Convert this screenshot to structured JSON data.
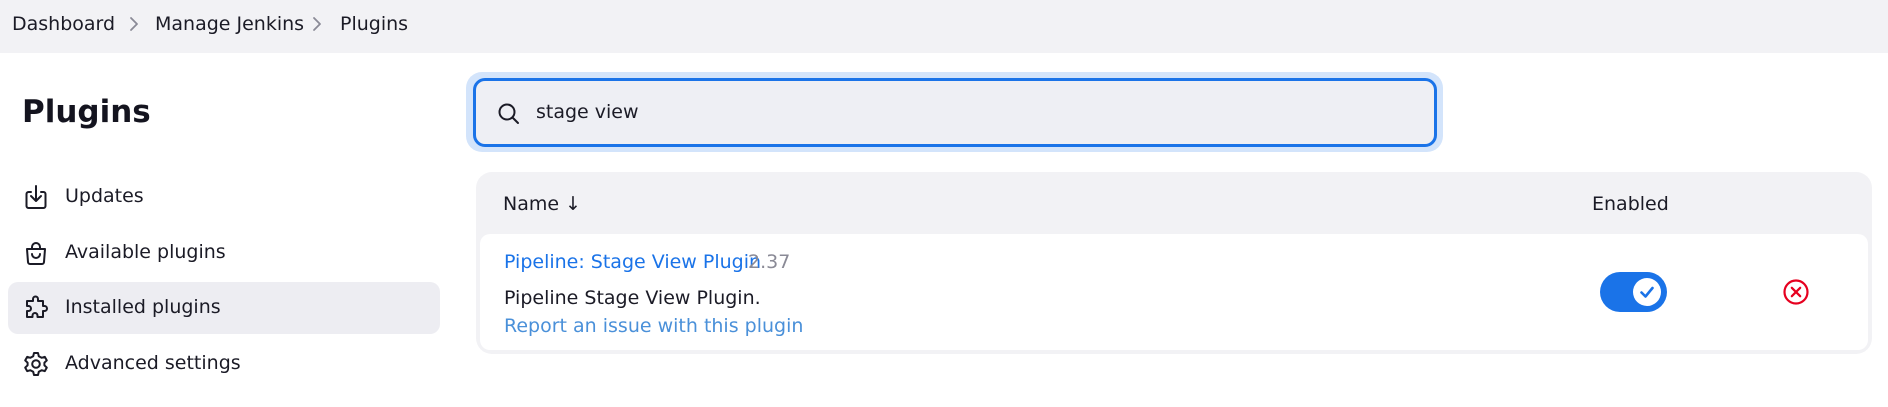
{
  "breadcrumb": {
    "items": [
      "Dashboard",
      "Manage Jenkins",
      "Plugins"
    ]
  },
  "sidebar": {
    "title": "Plugins",
    "items": [
      {
        "label": "Updates",
        "icon": "download-icon"
      },
      {
        "label": "Available plugins",
        "icon": "shopping-bag-icon"
      },
      {
        "label": "Installed plugins",
        "icon": "puzzle-icon",
        "active": true
      },
      {
        "label": "Advanced settings",
        "icon": "gear-icon"
      }
    ]
  },
  "search": {
    "value": "stage view",
    "icon": "search-icon"
  },
  "table": {
    "headers": {
      "name": "Name ↓",
      "enabled": "Enabled"
    },
    "rows": [
      {
        "name": "Pipeline: Stage View Plugin",
        "version": "2.37",
        "description": "Pipeline Stage View Plugin.",
        "report_link": "Report an issue with this plugin",
        "enabled": true
      }
    ]
  },
  "colors": {
    "accent": "#1a73e8",
    "danger": "#e6001f",
    "link_muted": "#4a90d9",
    "breadcrumb_bg": "#f2f2f5"
  }
}
